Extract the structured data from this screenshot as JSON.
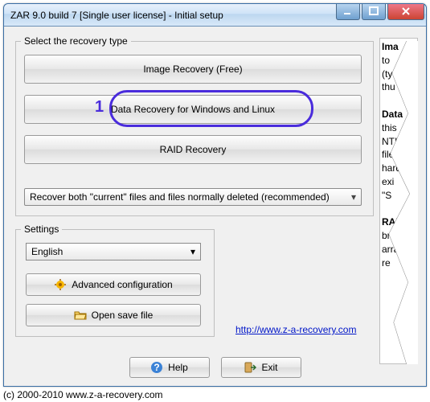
{
  "window": {
    "title": "ZAR 9.0 build 7 [Single user license] - Initial setup"
  },
  "recovery": {
    "group_label": "Select the recovery type",
    "image_btn": "Image Recovery (Free)",
    "data_btn": "Data Recovery for Windows and Linux",
    "raid_btn": "RAID Recovery",
    "mode_combo": "Recover both \"current\" files and files normally deleted (recommended)",
    "step": "1"
  },
  "settings": {
    "group_label": "Settings",
    "language": "English",
    "adv_btn": "Advanced configuration",
    "open_btn": "Open save file"
  },
  "link": {
    "url": "http://www.z-a-recovery.com"
  },
  "side": {
    "l1b": "Ima",
    "l2": "to",
    "l3": "(ty",
    "l4": "thu",
    "l5b": "Data",
    "l6": "this",
    "l7": "NTI",
    "l8": "files",
    "l9": "hard",
    "l10": "exi",
    "l11": "\"S",
    "l12b": "RAI",
    "l13": "brok",
    "l14": "arra",
    "l15": "re"
  },
  "bottom": {
    "help": "Help",
    "exit": "Exit"
  },
  "copyright": "(c) 2000-2010 www.z-a-recovery.com"
}
